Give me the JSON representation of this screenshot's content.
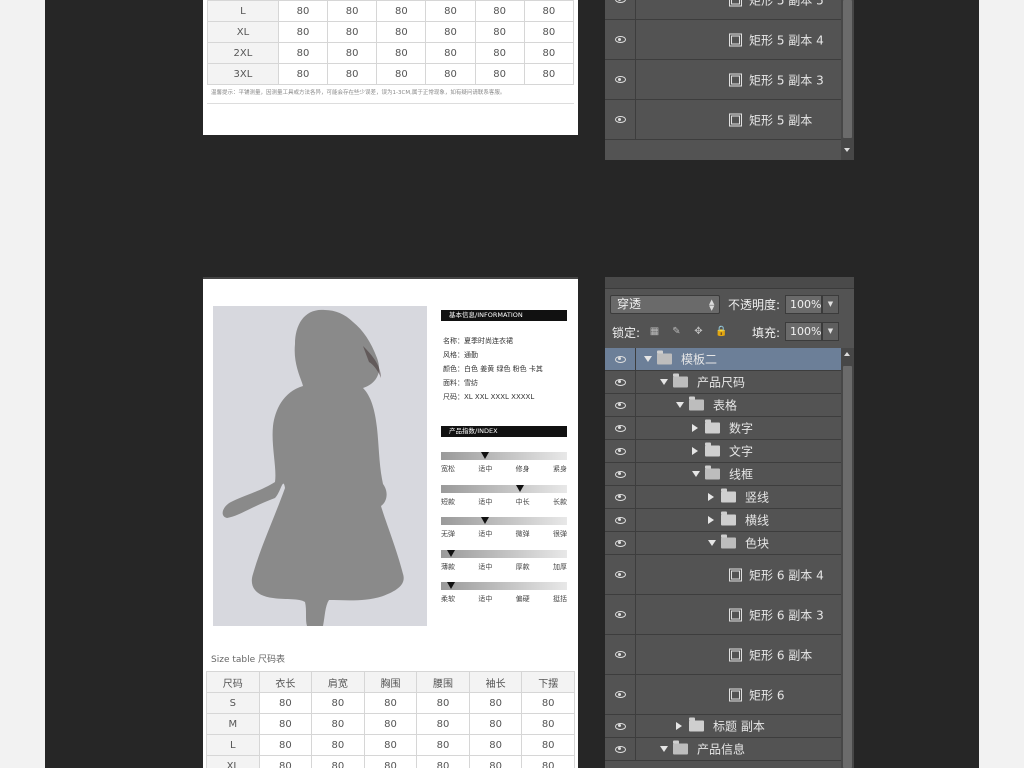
{
  "top_card": {
    "rows": [
      {
        "size": "L",
        "values": [
          "80",
          "80",
          "80",
          "80",
          "80",
          "80"
        ]
      },
      {
        "size": "XL",
        "values": [
          "80",
          "80",
          "80",
          "80",
          "80",
          "80"
        ]
      },
      {
        "size": "2XL",
        "values": [
          "80",
          "80",
          "80",
          "80",
          "80",
          "80"
        ]
      },
      {
        "size": "3XL",
        "values": [
          "80",
          "80",
          "80",
          "80",
          "80",
          "80"
        ]
      }
    ],
    "note": "温馨提示：平铺测量，因测量工具或方法各异，可能会存在些少误差，误为1-3CM,属于正常现象，如有疑问请联系客服。"
  },
  "top_layers": [
    {
      "name": "矩形 5 副本 5"
    },
    {
      "name": "矩形 5 副本 4"
    },
    {
      "name": "矩形 5 副本 3"
    },
    {
      "name": "矩形 5 副本"
    }
  ],
  "product": {
    "info_header": "基本信息/INFORMATION",
    "info_lines": [
      "名称：夏季时尚连衣裙",
      "风格：通勤",
      "颜色：白色  姜黄  绿色  粉色  卡其",
      "面料：雪纺",
      "尺码：XL  XXL  XXXL  XXXXL"
    ],
    "index_header": "产品指数/INDEX",
    "indices": [
      {
        "labels": [
          "宽松",
          "适中",
          "修身",
          "紧身"
        ],
        "level": 0.35
      },
      {
        "labels": [
          "短款",
          "适中",
          "中长",
          "长款"
        ],
        "level": 0.63
      },
      {
        "labels": [
          "无弹",
          "适中",
          "微弹",
          "很弹"
        ],
        "level": 0.35
      },
      {
        "labels": [
          "薄款",
          "适中",
          "厚款",
          "加厚"
        ],
        "level": 0.08
      },
      {
        "labels": [
          "柔软",
          "适中",
          "偏硬",
          "挺括"
        ],
        "level": 0.08
      }
    ],
    "size_table_title": "Size table  尺码表",
    "size_headers": [
      "尺码",
      "衣长",
      "肩宽",
      "胸围",
      "腰围",
      "袖长",
      "下摆"
    ],
    "size_rows": [
      {
        "size": "S",
        "values": [
          "80",
          "80",
          "80",
          "80",
          "80",
          "80"
        ]
      },
      {
        "size": "M",
        "values": [
          "80",
          "80",
          "80",
          "80",
          "80",
          "80"
        ]
      },
      {
        "size": "L",
        "values": [
          "80",
          "80",
          "80",
          "80",
          "80",
          "80"
        ]
      },
      {
        "size": "XL",
        "values": [
          "80",
          "80",
          "80",
          "80",
          "80",
          "80"
        ]
      }
    ]
  },
  "layers_panel": {
    "blend_mode": "穿透",
    "opacity_label": "不透明度:",
    "opacity_value": "100%",
    "lock_label": "锁定:",
    "fill_label": "填充:",
    "fill_value": "100%",
    "layers": [
      {
        "name": "模板二",
        "type": "group",
        "expanded": true,
        "depth": 0,
        "selected": true
      },
      {
        "name": "产品尺码",
        "type": "group",
        "expanded": true,
        "depth": 1
      },
      {
        "name": "表格",
        "type": "group",
        "expanded": true,
        "depth": 2
      },
      {
        "name": "数字",
        "type": "group",
        "expanded": false,
        "depth": 3
      },
      {
        "name": "文字",
        "type": "group",
        "expanded": false,
        "depth": 3
      },
      {
        "name": "线框",
        "type": "group",
        "expanded": true,
        "depth": 3
      },
      {
        "name": "竖线",
        "type": "group",
        "expanded": false,
        "depth": 4
      },
      {
        "name": "横线",
        "type": "group",
        "expanded": false,
        "depth": 4
      },
      {
        "name": "色块",
        "type": "group",
        "expanded": true,
        "depth": 4
      },
      {
        "name": "矩形 6 副本 4",
        "type": "shape",
        "depth": 5
      },
      {
        "name": "矩形 6 副本 3",
        "type": "shape",
        "depth": 5
      },
      {
        "name": "矩形 6 副本",
        "type": "shape",
        "depth": 5
      },
      {
        "name": "矩形 6",
        "type": "shape",
        "depth": 5
      },
      {
        "name": "标题 副本",
        "type": "group",
        "expanded": false,
        "depth": 2
      },
      {
        "name": "产品信息",
        "type": "group",
        "expanded": true,
        "depth": 1
      }
    ]
  },
  "colors": {
    "workspace": "#262626",
    "panel": "#535353",
    "selected_layer": "#6c7f98",
    "silhouette": "#8a8a8a"
  }
}
